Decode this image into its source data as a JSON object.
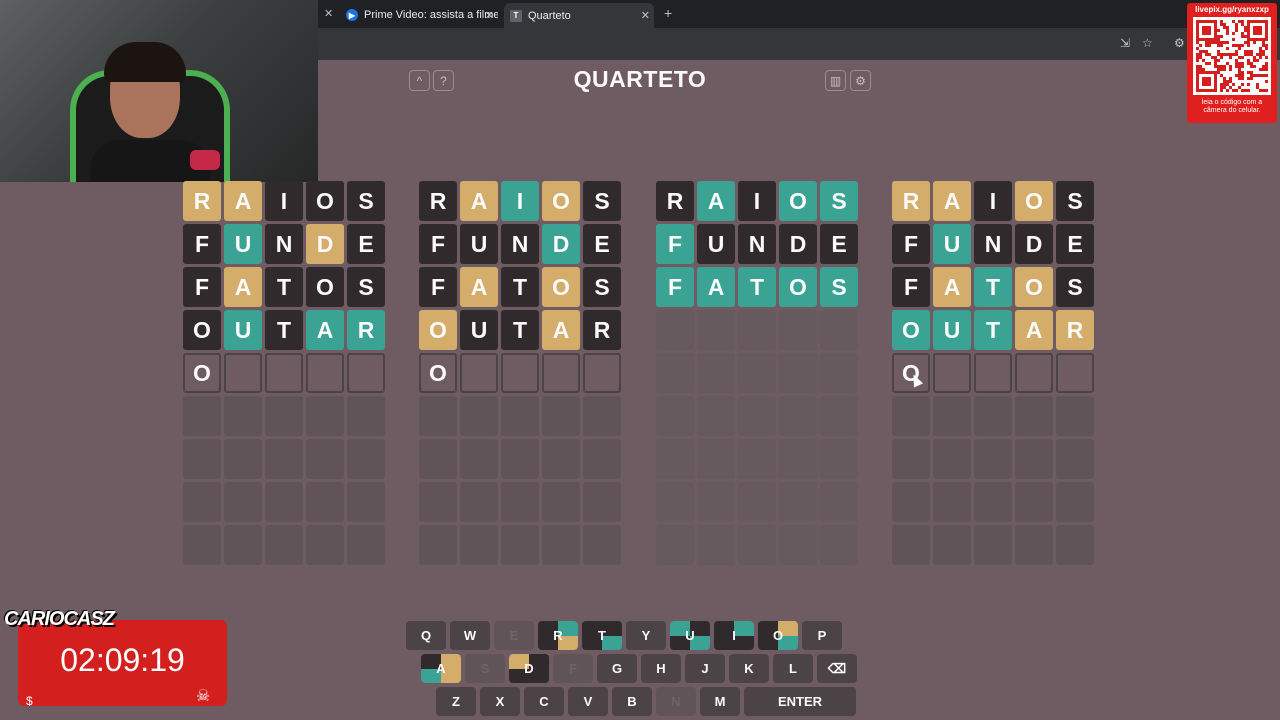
{
  "browser": {
    "tabs": [
      {
        "title": "Prime Video: assista a filmes, sé",
        "favicon": "prime-video-icon"
      },
      {
        "title": "Quarteto",
        "favicon": "T",
        "active": true
      }
    ]
  },
  "qr_overlay": {
    "url": "livepix.gg/ryanxzxp",
    "caption": "leia o código com a câmera do celular."
  },
  "game": {
    "title": "QUARTETO",
    "boards": [
      {
        "rows": [
          {
            "letters": [
              "R",
              "A",
              "I",
              "O",
              "S"
            ],
            "colors": [
              "y",
              "y",
              "b",
              "b",
              "b"
            ]
          },
          {
            "letters": [
              "F",
              "U",
              "N",
              "D",
              "E"
            ],
            "colors": [
              "b",
              "g",
              "b",
              "y",
              "b"
            ]
          },
          {
            "letters": [
              "F",
              "A",
              "T",
              "O",
              "S"
            ],
            "colors": [
              "b",
              "y",
              "b",
              "b",
              "b"
            ]
          },
          {
            "letters": [
              "O",
              "U",
              "T",
              "A",
              "R"
            ],
            "colors": [
              "b",
              "g",
              "b",
              "g",
              "g"
            ]
          }
        ],
        "current": [
          "O",
          "",
          "",
          "",
          ""
        ]
      },
      {
        "rows": [
          {
            "letters": [
              "R",
              "A",
              "I",
              "O",
              "S"
            ],
            "colors": [
              "b",
              "y",
              "g",
              "y",
              "b"
            ]
          },
          {
            "letters": [
              "F",
              "U",
              "N",
              "D",
              "E"
            ],
            "colors": [
              "b",
              "b",
              "b",
              "g",
              "b"
            ]
          },
          {
            "letters": [
              "F",
              "A",
              "T",
              "O",
              "S"
            ],
            "colors": [
              "b",
              "y",
              "b",
              "y",
              "b"
            ]
          },
          {
            "letters": [
              "O",
              "U",
              "T",
              "A",
              "R"
            ],
            "colors": [
              "y",
              "b",
              "b",
              "y",
              "b"
            ]
          }
        ],
        "current": [
          "O",
          "",
          "",
          "",
          ""
        ]
      },
      {
        "rows": [
          {
            "letters": [
              "R",
              "A",
              "I",
              "O",
              "S"
            ],
            "colors": [
              "b",
              "g",
              "b",
              "g",
              "g"
            ]
          },
          {
            "letters": [
              "F",
              "U",
              "N",
              "D",
              "E"
            ],
            "colors": [
              "g",
              "b",
              "b",
              "b",
              "b"
            ]
          },
          {
            "letters": [
              "F",
              "A",
              "T",
              "O",
              "S"
            ],
            "colors": [
              "g",
              "g",
              "g",
              "g",
              "g"
            ]
          }
        ],
        "solved": true
      },
      {
        "rows": [
          {
            "letters": [
              "R",
              "A",
              "I",
              "O",
              "S"
            ],
            "colors": [
              "y",
              "y",
              "b",
              "y",
              "b"
            ]
          },
          {
            "letters": [
              "F",
              "U",
              "N",
              "D",
              "E"
            ],
            "colors": [
              "b",
              "g",
              "b",
              "b",
              "b"
            ]
          },
          {
            "letters": [
              "F",
              "A",
              "T",
              "O",
              "S"
            ],
            "colors": [
              "b",
              "y",
              "g",
              "y",
              "b"
            ]
          },
          {
            "letters": [
              "O",
              "U",
              "T",
              "A",
              "R"
            ],
            "colors": [
              "g",
              "g",
              "g",
              "y",
              "y"
            ]
          }
        ],
        "current": [
          "O",
          "",
          "",
          "",
          ""
        ]
      }
    ],
    "keyboard": {
      "row1": [
        {
          "k": "Q"
        },
        {
          "k": "W"
        },
        {
          "k": "E",
          "used": true
        },
        {
          "k": "R",
          "q": [
            "b",
            "g",
            "b",
            "y"
          ]
        },
        {
          "k": "T",
          "q": [
            "b",
            "b",
            "b",
            "g"
          ]
        },
        {
          "k": "Y"
        },
        {
          "k": "U",
          "q": [
            "g",
            "b",
            "b",
            "g"
          ]
        },
        {
          "k": "I",
          "q": [
            "b",
            "g",
            "b",
            "b"
          ]
        },
        {
          "k": "O",
          "q": [
            "b",
            "y",
            "b",
            "g"
          ]
        },
        {
          "k": "P"
        }
      ],
      "row2": [
        {
          "k": "A",
          "q": [
            "b",
            "y",
            "g",
            "y"
          ]
        },
        {
          "k": "S",
          "used": true
        },
        {
          "k": "D",
          "q": [
            "y",
            "b",
            "b",
            "b"
          ]
        },
        {
          "k": "F",
          "used": true
        },
        {
          "k": "G"
        },
        {
          "k": "H"
        },
        {
          "k": "J"
        },
        {
          "k": "K"
        },
        {
          "k": "L"
        },
        {
          "k": "⌫"
        }
      ],
      "row3": [
        {
          "k": "Z"
        },
        {
          "k": "X"
        },
        {
          "k": "C"
        },
        {
          "k": "V"
        },
        {
          "k": "B"
        },
        {
          "k": "N",
          "used": true
        },
        {
          "k": "M"
        },
        {
          "k": "ENTER",
          "wide": true
        }
      ]
    }
  },
  "stream": {
    "brand": "CARIOCASZ",
    "timer": "02:09:19"
  },
  "colors": {
    "y": "#d3ad69",
    "g": "#3aa394",
    "b": "#312a2c"
  }
}
